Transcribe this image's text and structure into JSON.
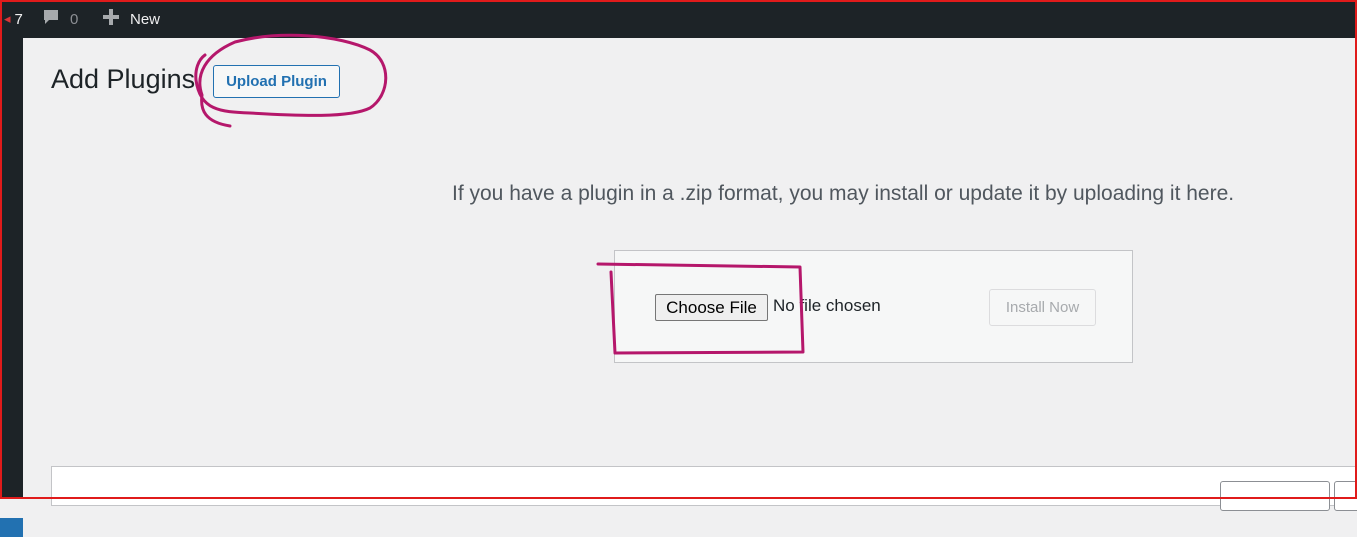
{
  "admin_bar": {
    "updates_count": "7",
    "comments_count": "0",
    "new_label": "New"
  },
  "page": {
    "title": "Add Plugins",
    "upload_button_label": "Upload Plugin"
  },
  "upload": {
    "help_text": "If you have a plugin in a .zip format, you may install or update it by uploading it here.",
    "choose_file_label": "Choose File",
    "no_file_text": "No file chosen",
    "install_button_label": "Install Now"
  },
  "colors": {
    "admin_bar": "#1d2327",
    "accent": "#2271b1",
    "annotation": "#b5176b",
    "frame": "#e01b1b"
  },
  "icons": [
    "updates-icon",
    "comment-bubble-icon",
    "plus-icon"
  ]
}
